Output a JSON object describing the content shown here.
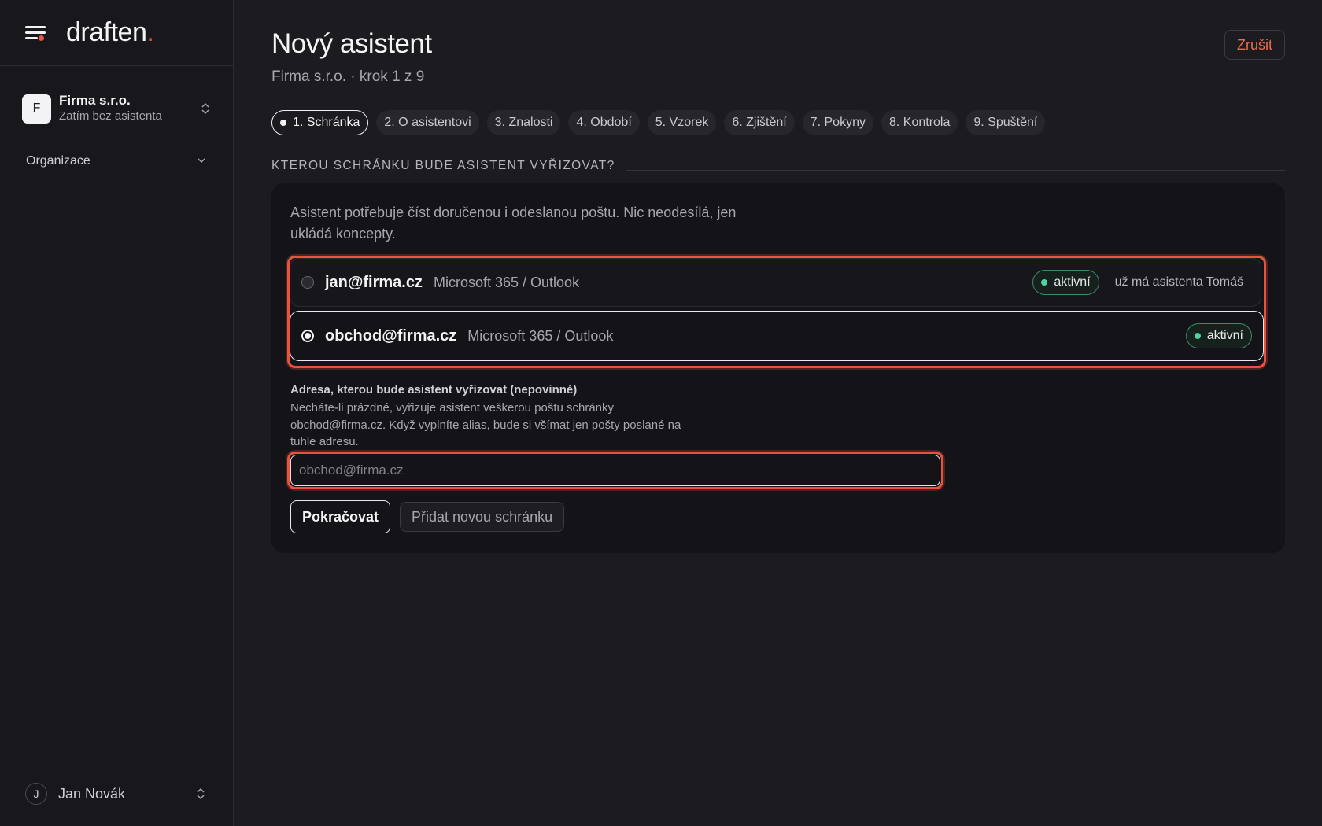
{
  "brand": {
    "name": "draften",
    "dot": "."
  },
  "sidebar": {
    "org": {
      "initial": "F",
      "name": "Firma s.r.o.",
      "subtitle": "Zatím bez asistenta"
    },
    "section": {
      "label": "Organizace"
    },
    "user": {
      "initial": "J",
      "name": "Jan Novák"
    }
  },
  "header": {
    "title": "Nový asistent",
    "subtitle": "Firma s.r.o. · krok 1 z 9",
    "cancel_label": "Zrušit"
  },
  "steps": [
    {
      "label": "1. Schránka",
      "active": true
    },
    {
      "label": "2. O asistentovi",
      "active": false
    },
    {
      "label": "3. Znalosti",
      "active": false
    },
    {
      "label": "4. Období",
      "active": false
    },
    {
      "label": "5. Vzorek",
      "active": false
    },
    {
      "label": "6. Zjištění",
      "active": false
    },
    {
      "label": "7. Pokyny",
      "active": false
    },
    {
      "label": "8. Kontrola",
      "active": false
    },
    {
      "label": "9. Spuštění",
      "active": false
    }
  ],
  "section_heading": "KTEROU SCHRÁNKU BUDE ASISTENT VYŘIZOVAT?",
  "card": {
    "description": "Asistent potřebuje číst doručenou i odeslanou poštu. Nic neodesílá, jen ukládá koncepty.",
    "mailboxes": [
      {
        "email": "jan@firma.cz",
        "provider": "Microsoft 365 / Outlook",
        "status": "aktivní",
        "note": "už má asistenta Tomáš",
        "selected": false
      },
      {
        "email": "obchod@firma.cz",
        "provider": "Microsoft 365 / Outlook",
        "status": "aktivní",
        "note": "",
        "selected": true
      }
    ],
    "alias": {
      "label": "Adresa, kterou bude asistent vyřizovat (nepovinné)",
      "help": "Necháte-li prázdné, vyřizuje asistent veškerou poštu schránky obchod@firma.cz. Když vyplníte alias, bude si všímat jen pošty poslané na tuhle adresu.",
      "value": "",
      "placeholder": "obchod@firma.cz"
    },
    "continue_label": "Pokračovat",
    "add_mailbox_label": "Přidat novou schránku"
  },
  "colors": {
    "accent": "#e8533f",
    "status_green": "#4fd1a0",
    "cancel": "#ef6a4f"
  }
}
